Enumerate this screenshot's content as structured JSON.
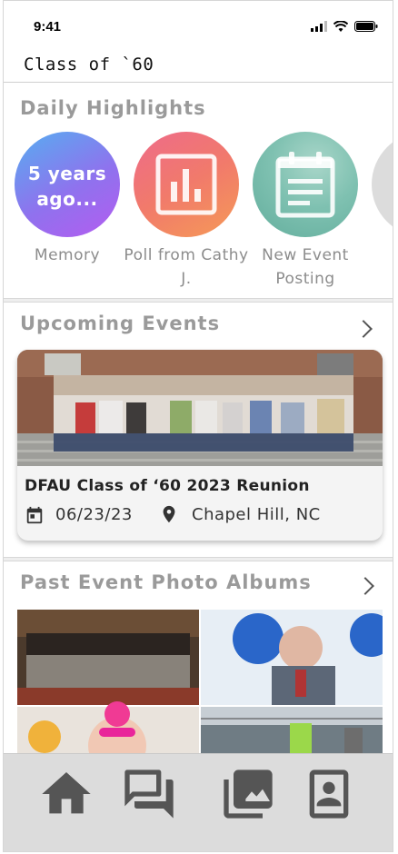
{
  "status_bar": {
    "time": "9:41"
  },
  "app": {
    "title": "Class of `60"
  },
  "daily_highlights": {
    "title": "Daily Highlights",
    "items": [
      {
        "circle_text": "5 years ago...",
        "label": "Memory"
      },
      {
        "icon": "poll-chart-icon",
        "label": "Poll from Cathy J."
      },
      {
        "icon": "event-posting-icon",
        "label": "New Event Posting"
      }
    ]
  },
  "upcoming_events": {
    "title": "Upcoming Events",
    "event": {
      "name": "DFAU Class of ‘60 2023 Reunion",
      "date": "06/23/23",
      "location": "Chapel Hill, NC"
    }
  },
  "past_albums": {
    "title": "Past Event Photo Albums"
  },
  "nav": {
    "items": [
      "home-icon",
      "chat-icon",
      "photo-album-icon",
      "contacts-book-icon"
    ]
  },
  "colors": {
    "nav_icon": "#555555",
    "section_title": "#9a9a9a",
    "nav_bg": "#dcdcdc"
  }
}
